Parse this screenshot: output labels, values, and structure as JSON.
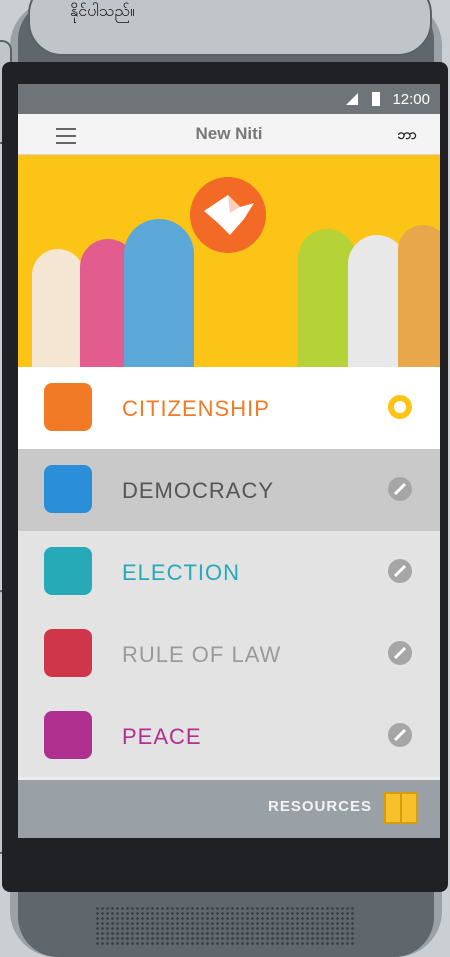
{
  "callout": {
    "text": "နိုင်ပါသည်။"
  },
  "status": {
    "time": "12:00"
  },
  "appbar": {
    "title": "New Niti",
    "badge": "ဘာ"
  },
  "menu": {
    "items": [
      {
        "label": "CITIZENSHIP",
        "color": "#f07a25",
        "icon": "group-icon",
        "bg": "#ffffff",
        "active": true
      },
      {
        "label": "DEMOCRACY",
        "color": "#555555",
        "icon": "ballot-icon",
        "bg": "#c9c9c9",
        "active": false
      },
      {
        "label": "ELECTION",
        "color": "#27aab8",
        "icon": "vote-icon",
        "bg": "#e3e3e3",
        "active": false
      },
      {
        "label": "RULE OF LAW",
        "color": "#9a9a9a",
        "icon": "court-icon",
        "bg": "#e3e3e3",
        "active": false
      },
      {
        "label": "PEACE",
        "color": "#b0308f",
        "icon": "dove-hand-icon",
        "bg": "#e3e3e3",
        "active": false
      }
    ]
  },
  "footer": {
    "resources_label": "RESOURCES"
  },
  "colors": {
    "accent": "#fcc416",
    "brand": "#f26a26"
  }
}
